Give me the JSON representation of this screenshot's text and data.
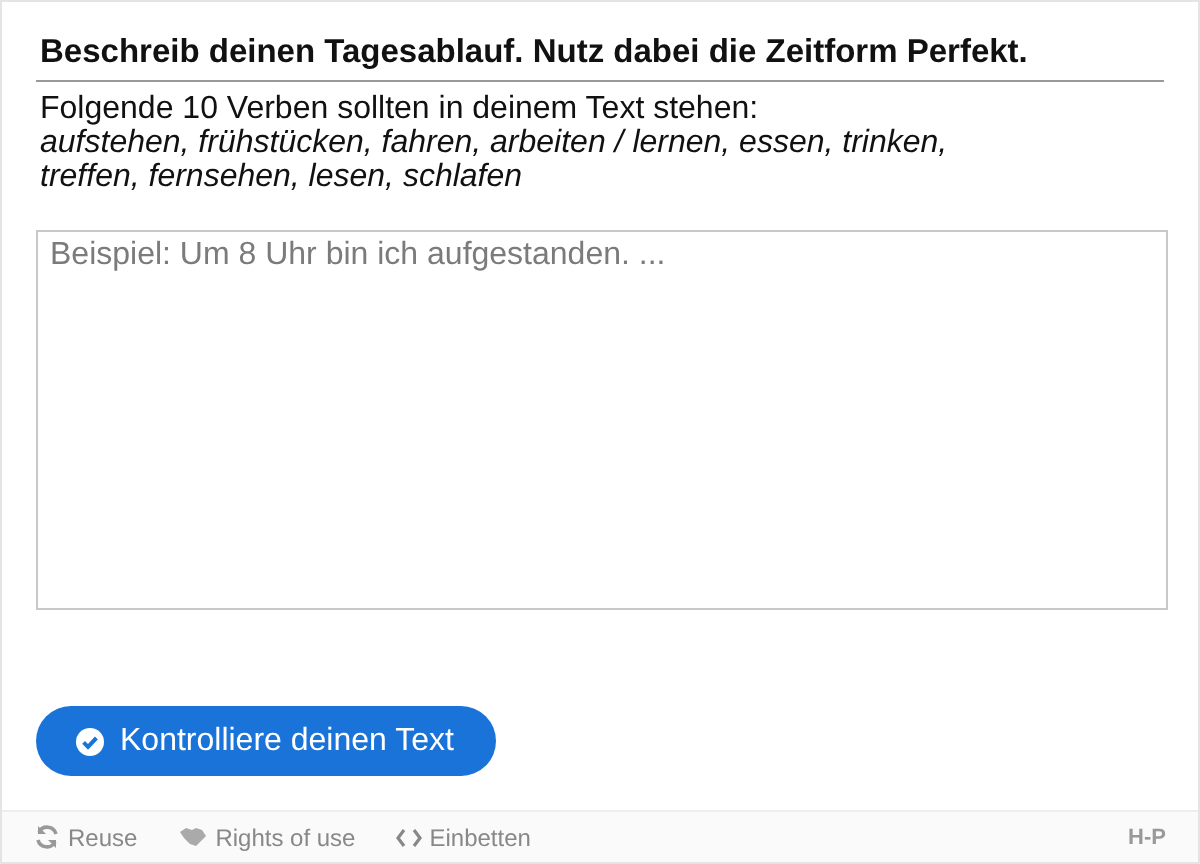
{
  "task": {
    "title": "Beschreib deinen Tagesablauf. Nutz dabei die Zeitform Perfekt.",
    "intro": "Folgende 10 Verben sollten in deinem Text stehen:",
    "verbs": [
      "aufstehen, frühstücken, fahren, arbeiten / lernen, essen, trinken,",
      "treffen, fernsehen, lesen, schlafen"
    ]
  },
  "answer": {
    "placeholder": "Beispiel: Um 8 Uhr bin ich aufgestanden. ..."
  },
  "check_button": {
    "label": "Kontrolliere deinen Text"
  },
  "footer": {
    "links": [
      {
        "kind": "reuse",
        "label": "Reuse"
      },
      {
        "kind": "rights",
        "label": "Rights of use"
      },
      {
        "kind": "embed",
        "label": "Einbetten"
      }
    ],
    "logo": "H-P"
  }
}
